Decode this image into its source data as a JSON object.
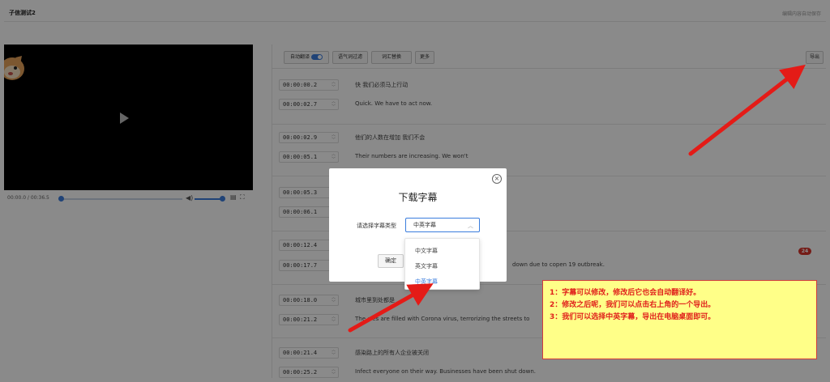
{
  "app": {
    "title": "子信测试2",
    "autosave_text": "编辑内容自动保存"
  },
  "player": {
    "time": "00:00.0 / 00:36.5",
    "volume_icon": "volume-icon",
    "progress_fraction": 0.0,
    "volume_fraction": 0.9
  },
  "toolbar": {
    "auto_translate": "自动翻译",
    "filter_filler": "语气词过滤",
    "replace_words": "词汇替换",
    "more": "更多",
    "export": "导出"
  },
  "cues": [
    {
      "start": "00:00:00.2",
      "end": "00:00:02.7",
      "zh": "快 我们必须马上行动",
      "en": "Quick. We have to act now."
    },
    {
      "start": "00:00:02.9",
      "end": "00:00:05.1",
      "zh": "他们的人数在增加 我们不会",
      "en": "Their numbers are increasing. We won't"
    },
    {
      "start": "00:00:05.3",
      "end": "00:00:06.1",
      "zh": "",
      "en": ""
    },
    {
      "start": "00:00:12.4",
      "end": "00:00:17.7",
      "zh": "",
      "en": "down due to copen 19 outbreak."
    },
    {
      "start": "00:00:18.0",
      "end": "00:00:21.2",
      "zh": "城市里到处都是",
      "en": "The c   es are filled with Corona virus, terrorizing the streets to"
    },
    {
      "start": "00:00:21.4",
      "end": "00:00:25.2",
      "zh": "感染路上的所有人企业被关闭",
      "en": "Infect everyone on their way. Businesses have been shut down."
    }
  ],
  "badge": "24",
  "modal": {
    "title": "下载字幕",
    "select_label": "请选择字幕类型",
    "selected": "中英字幕",
    "ok": "确定",
    "options": [
      "中文字幕",
      "英文字幕",
      "中英字幕"
    ]
  },
  "note": [
    "1：字幕可以修改，修改后它也会自动翻译好。",
    "2：修改之后呢，我们可以点击右上角的一个导出。",
    "3：我们可以选择中英字幕，导出在电脑桌面即可。"
  ],
  "colors": {
    "accent": "#3b7ddd",
    "annotation_red": "#e0201b",
    "note_bg": "#ffff88",
    "badge": "#d9342b"
  }
}
